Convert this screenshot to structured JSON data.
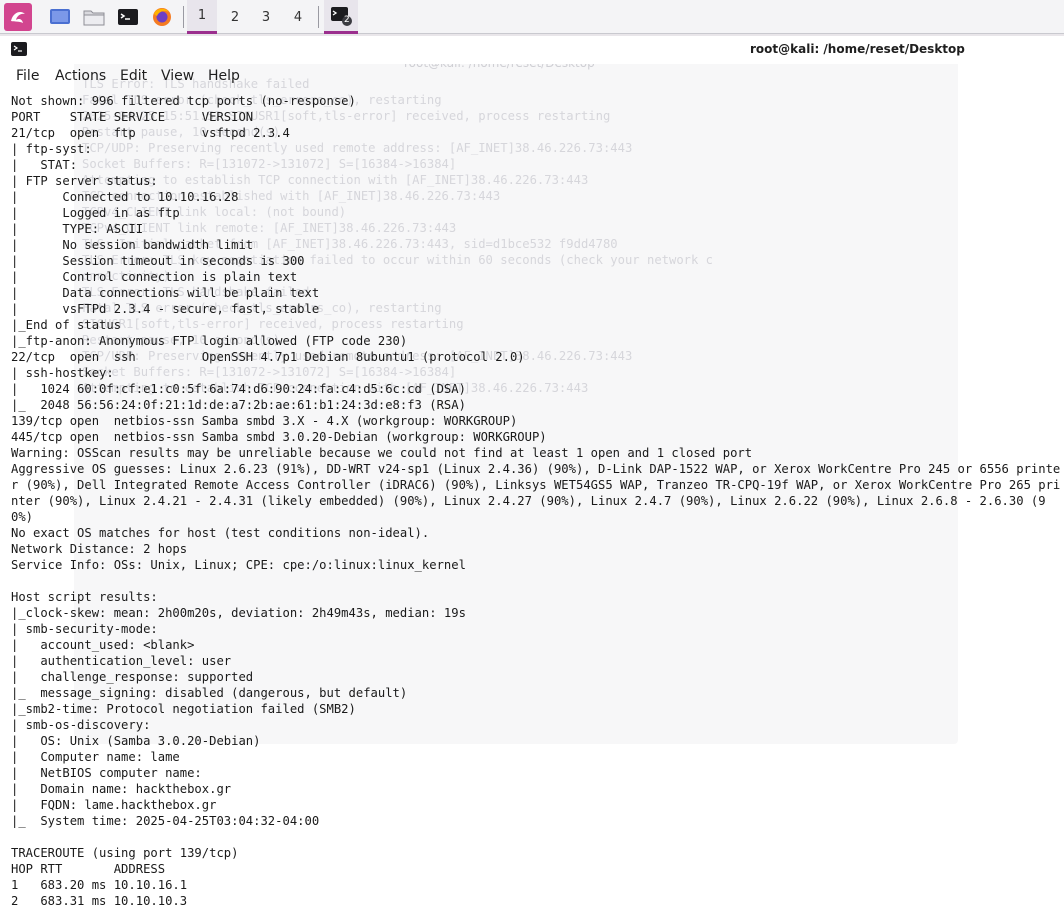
{
  "panel": {
    "workspaces": [
      "1",
      "2",
      "3",
      "4"
    ],
    "terminal_badge": "2",
    "icons": [
      "kali-dragon-icon",
      "show-desktop-icon",
      "file-manager-icon",
      "terminal-icon",
      "firefox-icon"
    ]
  },
  "window": {
    "title": "root@kali: /home/reset/Desktop"
  },
  "menu": {
    "file": "File",
    "actions": "Actions",
    "edit": "Edit",
    "view": "View",
    "help": "Help"
  },
  "ghost": {
    "title": "root@kali: /home/reset/Desktop",
    "lines": "TLS Error: TLS handshake failed\nFatal TLS error (check_tls_errors_co), restarting\n2025-04-25 15:51:52 SIGUSR1[soft,tls-error] received, process restarting\nRestart pause, 10 second(s)\nTCP/UDP: Preserving recently used remote address: [AF_INET]38.46.226.73:443\nSocket Buffers: R=[131072->131072] S=[16384->16384]\nAttempting to establish TCP connection with [AF_INET]38.46.226.73:443\nTCP connection established with [AF_INET]38.46.226.73:443\nTCPv4_CLIENT link local: (not bound)\nTCPv4_CLIENT link remote: [AF_INET]38.46.226.73:443\nTLS: Initial packet from [AF_INET]38.46.226.73:443, sid=d1bce532 f9dd4780\nTLS Error: TLS key negotiation failed to occur within 60 seconds (check your network c\nonnectivity)\nTLS Error: TLS handshake failed\nFatal TLS error (check_tls_errors_co), restarting\nSIGUSR1[soft,tls-error] received, process restarting\nRestart pause, 10 second(s)\nTCP/UDP: Preserving recently used remote address: [AF_INET]38.46.226.73:443\nSocket Buffers: R=[131072->131072] S=[16384->16384]\nAttempting to establish TCP connection with [AF_INET]38.46.226.73:443"
  },
  "terminal_output": "Not shown: 996 filtered tcp ports (no-response)\nPORT    STATE SERVICE     VERSION\n21/tcp  open  ftp         vsftpd 2.3.4\n| ftp-syst:\n|   STAT:\n| FTP server status:\n|      Connected to 10.10.16.28\n|      Logged in as ftp\n|      TYPE: ASCII\n|      No session bandwidth limit\n|      Session timeout in seconds is 300\n|      Control connection is plain text\n|      Data connections will be plain text\n|      vsFTPd 2.3.4 - secure, fast, stable\n|_End of status\n|_ftp-anon: Anonymous FTP login allowed (FTP code 230)\n22/tcp  open  ssh         OpenSSH 4.7p1 Debian 8ubuntu1 (protocol 2.0)\n| ssh-hostkey:\n|   1024 60:0f:cf:e1:c0:5f:6a:74:d6:90:24:fa:c4:d5:6c:cd (DSA)\n|_  2048 56:56:24:0f:21:1d:de:a7:2b:ae:61:b1:24:3d:e8:f3 (RSA)\n139/tcp open  netbios-ssn Samba smbd 3.X - 4.X (workgroup: WORKGROUP)\n445/tcp open  netbios-ssn Samba smbd 3.0.20-Debian (workgroup: WORKGROUP)\nWarning: OSScan results may be unreliable because we could not find at least 1 open and 1 closed port\nAggressive OS guesses: Linux 2.6.23 (91%), DD-WRT v24-sp1 (Linux 2.4.36) (90%), D-Link DAP-1522 WAP, or Xerox WorkCentre Pro 245 or 6556 printer (90%), Dell Integrated Remote Access Controller (iDRAC6) (90%), Linksys WET54GS5 WAP, Tranzeo TR-CPQ-19f WAP, or Xerox WorkCentre Pro 265 printer (90%), Linux 2.4.21 - 2.4.31 (likely embedded) (90%), Linux 2.4.27 (90%), Linux 2.4.7 (90%), Linux 2.6.22 (90%), Linux 2.6.8 - 2.6.30 (90%)\nNo exact OS matches for host (test conditions non-ideal).\nNetwork Distance: 2 hops\nService Info: OSs: Unix, Linux; CPE: cpe:/o:linux:linux_kernel\n\nHost script results:\n|_clock-skew: mean: 2h00m20s, deviation: 2h49m43s, median: 19s\n| smb-security-mode:\n|   account_used: <blank>\n|   authentication_level: user\n|   challenge_response: supported\n|_  message_signing: disabled (dangerous, but default)\n|_smb2-time: Protocol negotiation failed (SMB2)\n| smb-os-discovery:\n|   OS: Unix (Samba 3.0.20-Debian)\n|   Computer name: lame\n|   NetBIOS computer name:\n|   Domain name: hackthebox.gr\n|   FQDN: lame.hackthebox.gr\n|_  System time: 2025-04-25T03:04:32-04:00\n\nTRACEROUTE (using port 139/tcp)\nHOP RTT       ADDRESS\n1   683.20 ms 10.10.16.1\n2   683.31 ms 10.10.10.3"
}
